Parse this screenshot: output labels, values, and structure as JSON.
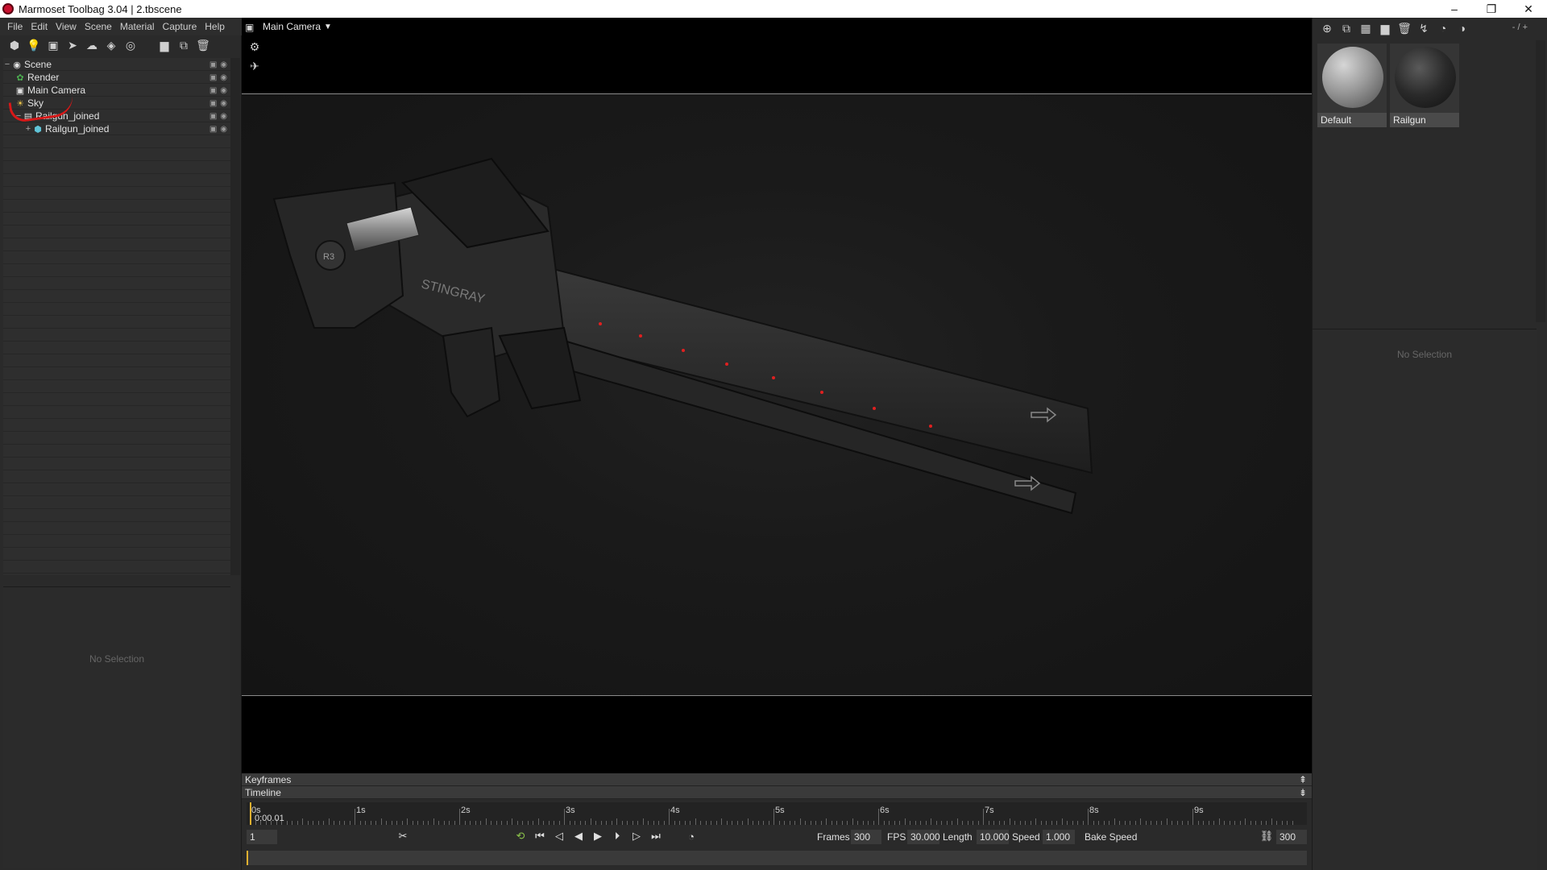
{
  "window": {
    "title": "Marmoset Toolbag 3.04  |  2.tbscene",
    "controls": [
      "–",
      "❐",
      "✕"
    ]
  },
  "menubar": [
    "File",
    "Edit",
    "View",
    "Scene",
    "Material",
    "Capture",
    "Help"
  ],
  "scene_tree": {
    "items": [
      {
        "label": "Scene",
        "icon": "scene-icon"
      },
      {
        "label": "Render",
        "icon": "render-icon"
      },
      {
        "label": "Main Camera",
        "icon": "camera-icon"
      },
      {
        "label": "Sky",
        "icon": "sky-icon"
      },
      {
        "label": "Railgun_joined",
        "icon": "group-icon"
      },
      {
        "label": "Railgun_joined",
        "icon": "mesh-icon"
      }
    ]
  },
  "left_props": {
    "empty_text": "No Selection"
  },
  "viewport": {
    "camera_label": "Main Camera",
    "model_text": "STINGRAY",
    "model_badge": "R3"
  },
  "materials": {
    "count": "- / +",
    "items": [
      {
        "label": "Default"
      },
      {
        "label": "Railgun"
      }
    ]
  },
  "right_props": {
    "empty_text": "No Selection"
  },
  "timeline": {
    "keyframes_label": "Keyframes",
    "timeline_label": "Timeline",
    "ticks": [
      "0s",
      "1s",
      "2s",
      "3s",
      "4s",
      "5s",
      "6s",
      "7s",
      "8s",
      "9s"
    ],
    "current_time": "0:00.01",
    "frame_field": "1",
    "frames_label": "Frames",
    "frames_value": "300",
    "fps_label": "FPS",
    "fps_value": "30.000",
    "length_label": "Length",
    "length_value": "10.000",
    "speed_label": "Speed",
    "speed_value": "1.000",
    "bake_label": "Bake Speed",
    "end_frame": "300",
    "progress": 0.0
  },
  "colors": {
    "accent_playhead": "#e0b030",
    "annotation_red": "#d81818",
    "render_green": "#4caf50"
  }
}
